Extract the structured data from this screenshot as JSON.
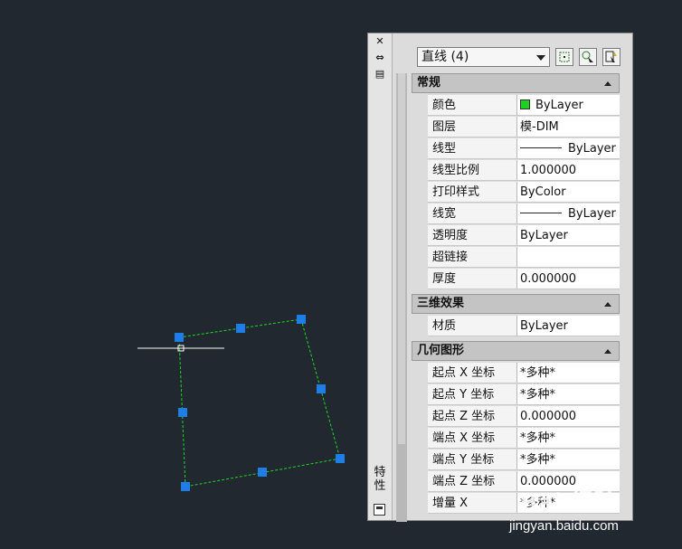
{
  "panel": {
    "title": "特性",
    "selection": "直线 (4)",
    "colors": {
      "panel_bg": "#dcdcdc",
      "canvas_bg": "#212830",
      "grip": "#1e7ee8",
      "line": "#22d422",
      "swatch": "#20d020"
    },
    "sections": [
      {
        "title": "常规",
        "rows": [
          {
            "label": "颜色",
            "value": "ByLayer"
          },
          {
            "label": "图层",
            "value": "模-DIM"
          },
          {
            "label": "线型",
            "value": "ByLayer"
          },
          {
            "label": "线型比例",
            "value": "1.000000"
          },
          {
            "label": "打印样式",
            "value": "ByColor"
          },
          {
            "label": "线宽",
            "value": "ByLayer"
          },
          {
            "label": "透明度",
            "value": "ByLayer"
          },
          {
            "label": "超链接",
            "value": ""
          },
          {
            "label": "厚度",
            "value": "0.000000"
          }
        ]
      },
      {
        "title": "三维效果",
        "rows": [
          {
            "label": "材质",
            "value": "ByLayer"
          }
        ]
      },
      {
        "title": "几何图形",
        "rows": [
          {
            "label": "起点 X 坐标",
            "value": "*多种*"
          },
          {
            "label": "起点 Y 坐标",
            "value": "*多种*"
          },
          {
            "label": "起点 Z 坐标",
            "value": "0.000000"
          },
          {
            "label": "端点 X 坐标",
            "value": "*多种*"
          },
          {
            "label": "端点 Y 坐标",
            "value": "*多种*"
          },
          {
            "label": "端点 Z 坐标",
            "value": "0.000000"
          },
          {
            "label": "增量 X",
            "value": "*多种*"
          }
        ]
      }
    ]
  },
  "watermark": {
    "logo": "Bai 经验",
    "url": "jingyan.baidu.com"
  }
}
